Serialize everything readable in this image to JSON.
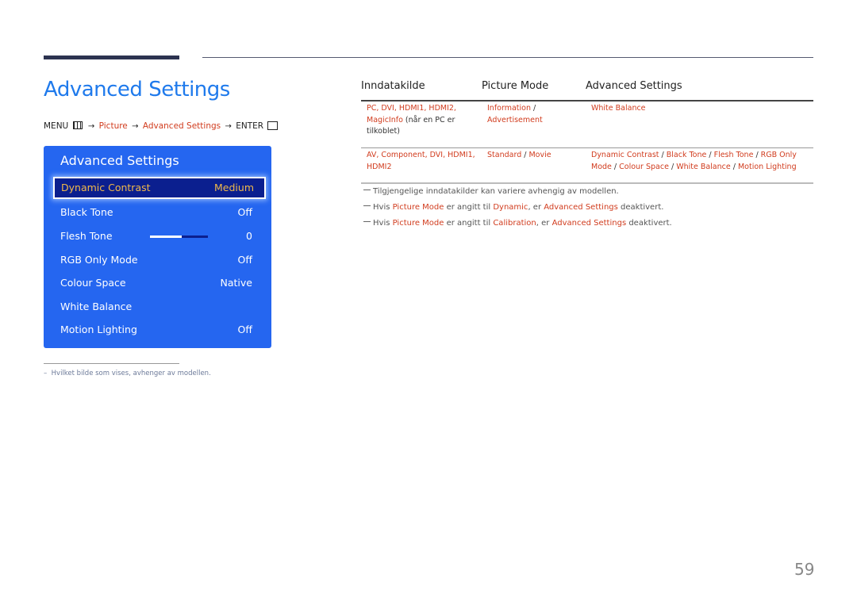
{
  "page": {
    "title": "Advanced Settings",
    "menu_path": {
      "menu_label": "MENU",
      "menu_icon": "menu-grid-icon",
      "arrow": "→",
      "step1": "Picture",
      "step2": "Advanced Settings",
      "enter_label": "ENTER",
      "enter_icon": "enter-icon"
    },
    "page_number": "59",
    "footnote": "Hvilket bilde som vises, avhenger av modellen.",
    "footnote_dash": "–"
  },
  "osd": {
    "title": "Advanced Settings",
    "items": [
      {
        "label": "Dynamic Contrast",
        "value": "Medium",
        "selected": true
      },
      {
        "label": "Black Tone",
        "value": "Off"
      },
      {
        "label": "Flesh Tone",
        "value": "0",
        "slider_fraction": 0.55
      },
      {
        "label": "RGB Only Mode",
        "value": "Off"
      },
      {
        "label": "Colour Space",
        "value": "Native"
      },
      {
        "label": "White Balance",
        "value": ""
      },
      {
        "label": "Motion Lighting",
        "value": "Off"
      }
    ]
  },
  "table": {
    "headers": [
      "Inndatakilde",
      "Picture Mode",
      "Advanced Settings"
    ],
    "rows": [
      {
        "source_red": "PC, DVI, HDMI1, HDMI2,",
        "source_red2": "MagicInfo",
        "source_plain": " (når en PC er",
        "source_plain2": "tilkoblet)",
        "mode_red": "Information",
        "mode_sep": " /",
        "mode_red2": "Advertisement",
        "settings_line1": "White Balance",
        "settings_line2": ""
      },
      {
        "source_red": "AV, Component, DVI, HDMI1,",
        "source_red2": "HDMI2",
        "mode_red": "Standard",
        "mode_sep": " / ",
        "mode_red2": "Movie",
        "settings_parts1": [
          "Dynamic Contrast",
          " / ",
          "Black Tone",
          " / ",
          "Flesh Tone",
          " / ",
          "RGB Only"
        ],
        "settings_parts2": [
          "Mode",
          " / ",
          "Colour Space",
          " / ",
          "White Balance",
          " / ",
          "Motion Lighting"
        ]
      }
    ]
  },
  "notes": [
    {
      "text": "Tilgjengelige inndatakilder kan variere avhengig av modellen."
    },
    {
      "p1": "Hvis ",
      "r1": "Picture Mode",
      "p2": " er angitt til ",
      "r2": "Dynamic",
      "p3": ", er ",
      "r3": "Advanced Settings",
      "p4": " deaktivert."
    },
    {
      "p1": "Hvis ",
      "r1": "Picture Mode",
      "p2": " er angitt til ",
      "r2": "Calibration",
      "p3": ", er ",
      "r3": "Advanced Settings",
      "p4": " deaktivert."
    }
  ],
  "colors": {
    "title_blue": "#1f7aec",
    "link_red": "#d13c1e",
    "osd_bg": "#2566f0",
    "osd_selected_bg": "#0b1f8f",
    "osd_selected_text": "#f1b94a"
  }
}
